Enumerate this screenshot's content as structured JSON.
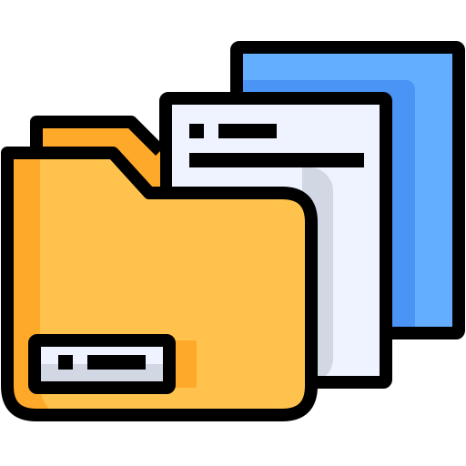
{
  "icon": {
    "name": "folder-with-documents-icon",
    "colors": {
      "outline": "#000000",
      "folder_front": "#FFC34D",
      "folder_shadow": "#FFA92B",
      "folder_back": "#FFA92B",
      "doc_front": "#EEF3FF",
      "doc_front_shade": "#D1D7E3",
      "doc_back": "#64AEFF",
      "doc_back_shade": "#4994F5",
      "label_fill": "#EEF3FF",
      "label_shade": "#D1D7E3"
    }
  }
}
